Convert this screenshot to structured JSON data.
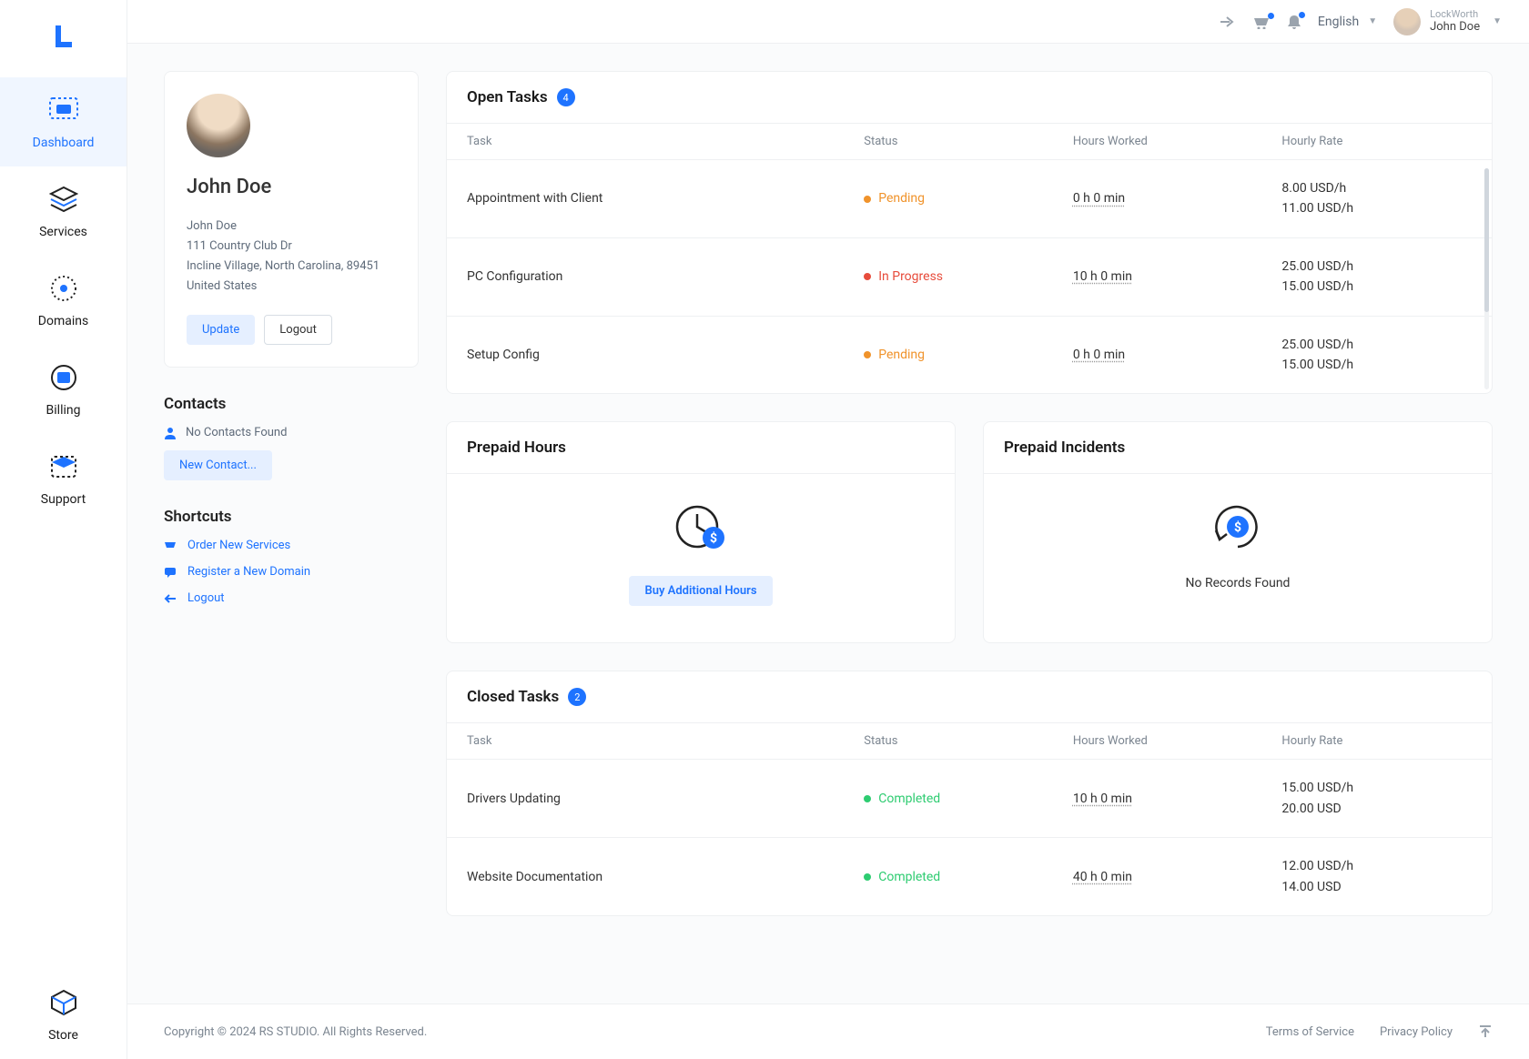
{
  "sidebar": {
    "items": [
      {
        "label": "Dashboard"
      },
      {
        "label": "Services"
      },
      {
        "label": "Domains"
      },
      {
        "label": "Billing"
      },
      {
        "label": "Support"
      }
    ],
    "store": {
      "label": "Store"
    }
  },
  "topbar": {
    "language": "English",
    "org": "LockWorth",
    "user": "John Doe"
  },
  "profile": {
    "name": "John Doe",
    "addr_name": "John Doe",
    "addr_line1": "111 Country Club Dr",
    "addr_line2": "Incline Village, North Carolina, 89451",
    "addr_country": "United States",
    "update_label": "Update",
    "logout_label": "Logout"
  },
  "contacts": {
    "title": "Contacts",
    "empty": "No Contacts Found",
    "new_label": "New Contact..."
  },
  "shortcuts": {
    "title": "Shortcuts",
    "items": [
      {
        "label": "Order New Services"
      },
      {
        "label": "Register a New Domain"
      },
      {
        "label": "Logout"
      }
    ]
  },
  "open_tasks": {
    "title": "Open Tasks",
    "count": "4",
    "cols": {
      "task": "Task",
      "status": "Status",
      "hours": "Hours Worked",
      "rate": "Hourly Rate"
    },
    "rows": [
      {
        "task": "Appointment with Client",
        "status": "Pending",
        "status_class": "pending",
        "hours": "0 h 0 min",
        "rate1": "8.00 USD/h",
        "rate2": "11.00 USD/h"
      },
      {
        "task": "PC Configuration",
        "status": "In Progress",
        "status_class": "progress",
        "hours": "10 h 0 min",
        "rate1": "25.00 USD/h",
        "rate2": "15.00 USD/h"
      },
      {
        "task": "Setup Config",
        "status": "Pending",
        "status_class": "pending",
        "hours": "0 h 0 min",
        "rate1": "25.00 USD/h",
        "rate2": "15.00 USD/h"
      }
    ]
  },
  "prepaid_hours": {
    "title": "Prepaid Hours",
    "button": "Buy Additional Hours"
  },
  "prepaid_incidents": {
    "title": "Prepaid Incidents",
    "empty": "No Records Found"
  },
  "closed_tasks": {
    "title": "Closed Tasks",
    "count": "2",
    "cols": {
      "task": "Task",
      "status": "Status",
      "hours": "Hours Worked",
      "rate": "Hourly Rate"
    },
    "rows": [
      {
        "task": "Drivers Updating",
        "status": "Completed",
        "hours": "10 h 0 min",
        "rate1": "15.00 USD/h",
        "rate2": "20.00 USD"
      },
      {
        "task": "Website Documentation",
        "status": "Completed",
        "hours": "40 h 0 min",
        "rate1": "12.00 USD/h",
        "rate2": "14.00 USD"
      }
    ]
  },
  "footer": {
    "copyright": "Copyright © 2024 RS STUDIO. All Rights Reserved.",
    "tos": "Terms of Service",
    "privacy": "Privacy Policy"
  }
}
